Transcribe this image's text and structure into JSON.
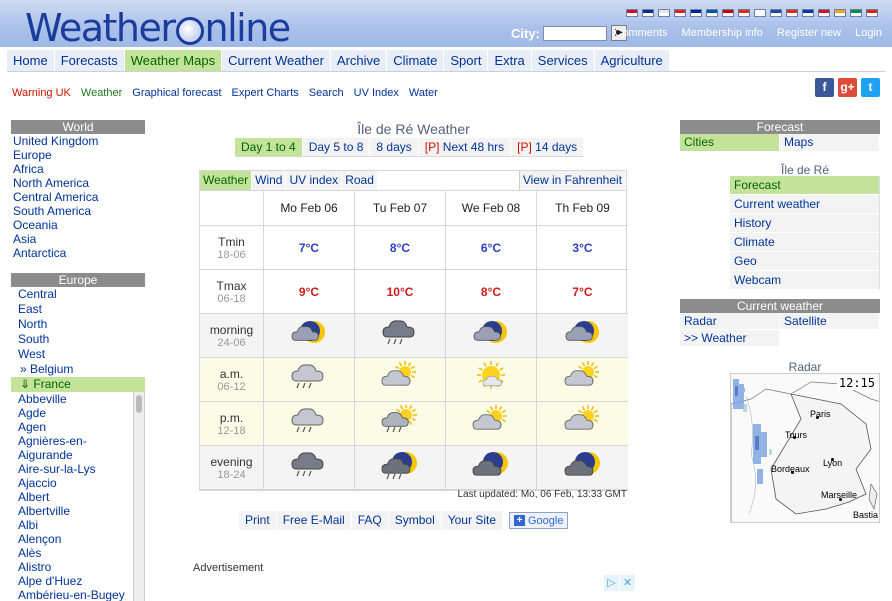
{
  "header": {
    "logo_left": "Weather",
    "logo_right": "nline",
    "city_label": "City:",
    "city_go": "▶",
    "toplinks": [
      "Comments",
      "Membership info",
      "Register new",
      "Login"
    ],
    "flags": [
      "#c8102e",
      "#0b2f8f",
      "#e5e5e5",
      "#d22",
      "#002395",
      "#0055a4",
      "#c00",
      "#de2910",
      "#fff",
      "#1f4aa8",
      "#d52b1e",
      "#0038a8",
      "#ce1126",
      "#f5a623",
      "#009246",
      "#da251d"
    ]
  },
  "mainnav": [
    {
      "label": "Home",
      "active": false
    },
    {
      "label": "Forecasts",
      "active": false
    },
    {
      "label": "Weather Maps",
      "active": true
    },
    {
      "label": "Current Weather",
      "active": false
    },
    {
      "label": "Archive",
      "active": false
    },
    {
      "label": "Climate",
      "active": false
    },
    {
      "label": "Sport",
      "active": false
    },
    {
      "label": "Extra",
      "active": false
    },
    {
      "label": "Services",
      "active": false
    },
    {
      "label": "Agriculture",
      "active": false
    }
  ],
  "subnav": [
    "Warning UK",
    "Weather",
    "Graphical forecast",
    "Expert Charts",
    "Search",
    "UV Index",
    "Water"
  ],
  "social": {
    "facebook": "f",
    "google": "g+",
    "twitter": "t"
  },
  "world": {
    "title": "World",
    "items": [
      "United Kingdom",
      "Europe",
      "Africa",
      "North America",
      "Central America",
      "South America",
      "Oceania",
      "Asia",
      "Antarctica"
    ]
  },
  "europe": {
    "title": "Europe",
    "regions": [
      "Central",
      "East",
      "North",
      "South",
      "West"
    ],
    "belgium": "» Belgium",
    "france": "⇓ France",
    "cities": [
      "Abbeville",
      "Agde",
      "Agen",
      "Agnières-en-",
      "Aigurande",
      "Aire-sur-la-Lys",
      "Ajaccio",
      "Albert",
      "Albertville",
      "Albi",
      "Alençon",
      "Alès",
      "Alistro",
      "Alpe d'Huez",
      "Ambérieu-en-Bugey"
    ]
  },
  "forecast": {
    "title": "Île de Ré Weather",
    "daytabs": [
      {
        "label": "Day 1 to 4",
        "active": true,
        "prefix": ""
      },
      {
        "label": "Day 5 to 8",
        "active": false,
        "prefix": ""
      },
      {
        "label": "8 days",
        "active": false,
        "prefix": ""
      },
      {
        "label": " Next 48 hrs",
        "active": false,
        "prefix": "[P]"
      },
      {
        "label": " 14 days",
        "active": false,
        "prefix": "[P]"
      }
    ],
    "tabs": [
      {
        "label": "Weather",
        "active": true
      },
      {
        "label": "Wind",
        "active": false
      },
      {
        "label": "UV index",
        "active": false
      },
      {
        "label": "Road",
        "active": false
      }
    ],
    "fahrenheit": "View in Fahrenheit",
    "days": [
      "Mo Feb 06",
      "Tu Feb 07",
      "We Feb 08",
      "Th Feb 09"
    ],
    "tmin": {
      "label": "Tmin",
      "hours": "18-06",
      "values": [
        "7°C",
        "8°C",
        "6°C",
        "3°C"
      ]
    },
    "tmax": {
      "label": "Tmax",
      "hours": "06-18",
      "values": [
        "9°C",
        "10°C",
        "8°C",
        "7°C"
      ]
    },
    "periods": [
      {
        "label": "morning",
        "hours": "24-06",
        "bg": "gry",
        "icons": [
          "moon-cloud",
          "cloud-dark-rain",
          "moon-cloud",
          "moon-cloud"
        ]
      },
      {
        "label": "a.m.",
        "hours": "06-12",
        "bg": "yel",
        "icons": [
          "cloud-rain",
          "sun-cloud",
          "sun-cloud-light",
          "sun-cloud"
        ]
      },
      {
        "label": "p.m.",
        "hours": "12-18",
        "bg": "yel",
        "icons": [
          "cloud-rain",
          "sun-cloud-rain",
          "sun-cloud",
          "sun-cloud"
        ]
      },
      {
        "label": "evening",
        "hours": "18-24",
        "bg": "gry",
        "icons": [
          "cloud-dark-rain",
          "moon-cloud-rain",
          "moon-cloud-dark",
          "moon-cloud-dark"
        ]
      }
    ],
    "updated": "Last updated: Mo, 06 Feb, 13:33 GMT"
  },
  "bottombar": [
    "Print",
    "Free E-Mail",
    "FAQ",
    "Symbol",
    "Your Site"
  ],
  "google_button": "Google",
  "advertisement": "Advertisement",
  "right": {
    "forecast_title": "Forecast",
    "cities": "Cities",
    "maps": "Maps",
    "place_title": "Île de Ré",
    "place_menu": [
      {
        "label": "Forecast",
        "active": true
      },
      {
        "label": "Current weather",
        "active": false
      },
      {
        "label": "History",
        "active": false
      },
      {
        "label": "Climate",
        "active": false
      },
      {
        "label": "Geo",
        "active": false
      },
      {
        "label": "Webcam",
        "active": false
      }
    ],
    "current_title": "Current weather",
    "radar": "Radar",
    "satellite": "Satellite",
    "weather_link": ">> Weather",
    "radar_title": "Radar",
    "radar_time": "12:15",
    "radar_cities": [
      {
        "name": "Paris"
      },
      {
        "name": "Tours"
      },
      {
        "name": "Bordeaux"
      },
      {
        "name": "Lyon"
      },
      {
        "name": "Marseille"
      },
      {
        "name": "Bastia"
      }
    ]
  }
}
